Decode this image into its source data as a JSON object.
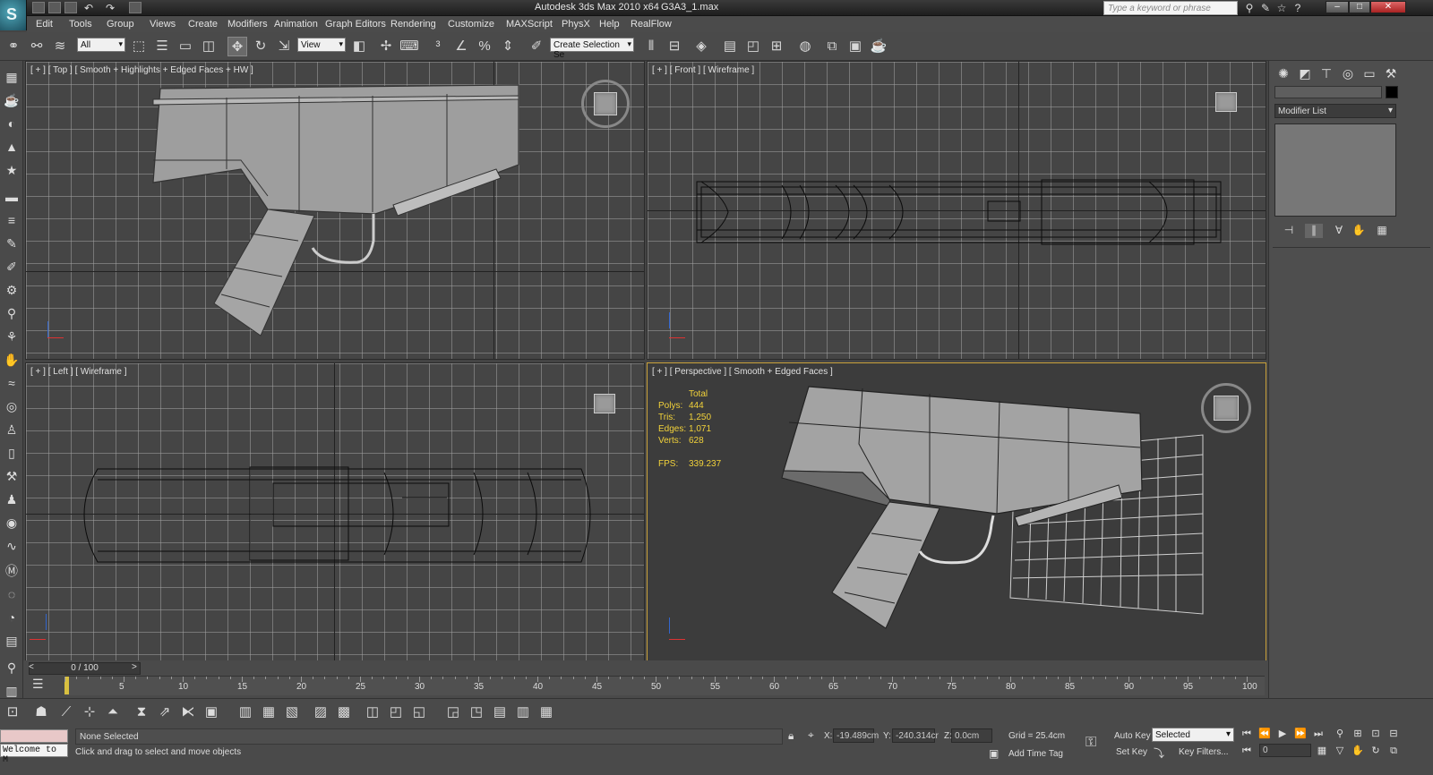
{
  "app": {
    "title": "Autodesk 3ds Max  2010 x64",
    "file": "G3A3_1.max",
    "search_placeholder": "Type a keyword or phrase"
  },
  "menus": [
    "Edit",
    "Tools",
    "Group",
    "Views",
    "Create",
    "Modifiers",
    "Animation",
    "Graph Editors",
    "Rendering",
    "Customize",
    "MAXScript",
    "PhysX",
    "Help",
    "RealFlow"
  ],
  "toolbar": {
    "filter": "All",
    "ref_coord": "View",
    "selection_set": "Create Selection Se"
  },
  "viewports": {
    "top": "[ + ] [ Top ] [ Smooth + Highlights + Edged Faces + HW ]",
    "front": "[ + ] [ Front ] [ Wireframe ]",
    "left": "[ + ] [ Left ] [ Wireframe ]",
    "perspective": "[ + ] [ Perspective ] [ Smooth + Edged Faces ]"
  },
  "stats": {
    "header": "Total",
    "polys_label": "Polys:",
    "polys": "444",
    "tris_label": "Tris:",
    "tris": "1,250",
    "edges_label": "Edges:",
    "edges": "1,071",
    "verts_label": "Verts:",
    "verts": "628",
    "fps_label": "FPS:",
    "fps": "339.237"
  },
  "command_panel": {
    "modifier_list": "Modifier List"
  },
  "timeline": {
    "frame": "0 / 100",
    "ticks": [
      "5",
      "10",
      "15",
      "20",
      "25",
      "30",
      "35",
      "40",
      "45",
      "50",
      "55",
      "60",
      "65",
      "70",
      "75",
      "80",
      "85",
      "90",
      "95",
      "100"
    ]
  },
  "status": {
    "listener": "Welcome to M",
    "selection": "None Selected",
    "prompt": "Click and drag to select and move objects",
    "x_label": "X:",
    "x": "-19.489cm",
    "y_label": "Y:",
    "y": "-240.314cr",
    "z_label": "Z:",
    "z": "0.0cm",
    "grid": "Grid = 25.4cm",
    "add_time_tag": "Add Time Tag",
    "auto_key": "Auto Key",
    "set_key": "Set Key",
    "key_mode": "Selected",
    "key_filters": "Key Filters...",
    "frame_field": "0"
  }
}
